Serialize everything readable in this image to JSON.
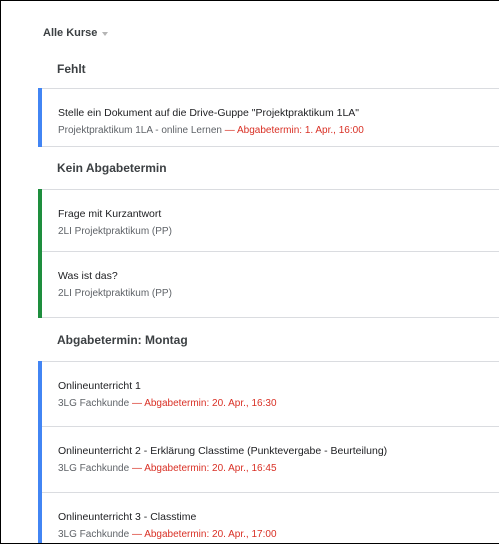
{
  "filter": {
    "label": "Alle Kurse"
  },
  "sections": {
    "missing": {
      "heading": "Fehlt",
      "items": [
        {
          "title": "Stelle ein Dokument auf die Drive-Guppe \"Projektpraktikum 1LA\"",
          "course": "Projektpraktikum 1LA - online Lernen",
          "sep": " — ",
          "due": "Abgabetermin: 1. Apr., 16:00"
        }
      ]
    },
    "nodue": {
      "heading": "Kein Abgabetermin",
      "items": [
        {
          "title": "Frage mit Kurzantwort",
          "course": "2LI Projektpraktikum (PP)"
        },
        {
          "title": "Was ist das?",
          "course": "2LI Projektpraktikum (PP)"
        }
      ]
    },
    "monday": {
      "heading": "Abgabetermin: Montag",
      "items": [
        {
          "title": "Onlineunterricht 1",
          "course": "3LG Fachkunde",
          "sep": " — ",
          "due": "Abgabetermin: 20. Apr., 16:30"
        },
        {
          "title": "Onlineunterricht 2 - Erklärung Classtime (Punktevergabe - Beurteilung)",
          "course": "3LG Fachkunde",
          "sep": " — ",
          "due": "Abgabetermin: 20. Apr., 16:45"
        },
        {
          "title": "Onlineunterricht 3 - Classtime",
          "course": "3LG Fachkunde",
          "sep": " — ",
          "due": "Abgabetermin: 20. Apr., 17:00"
        }
      ]
    }
  },
  "colors": {
    "blue": "#4285f4",
    "green": "#1e8e3e",
    "due_red": "#d93025"
  }
}
